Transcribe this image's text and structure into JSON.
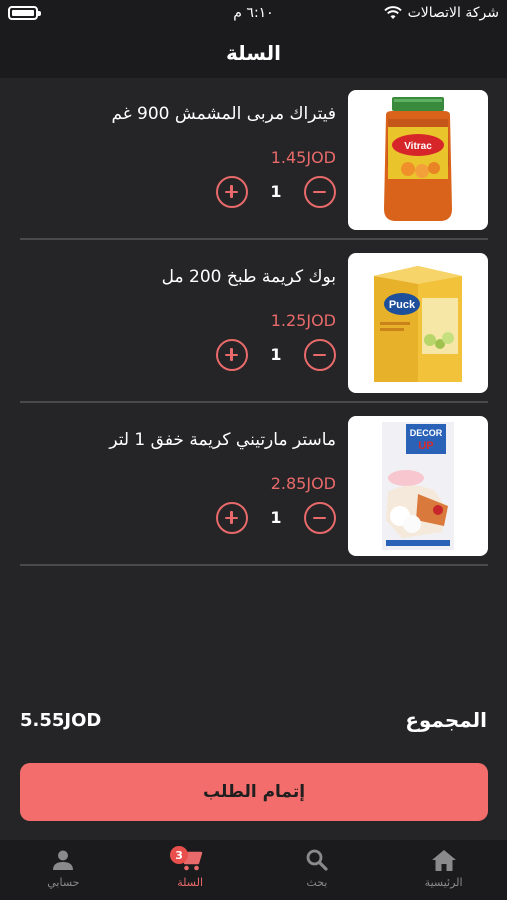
{
  "status_bar": {
    "carrier": "شركة الاتصالات",
    "time": "٦:١٠ م"
  },
  "header": {
    "title": "السلة"
  },
  "cart": {
    "items": [
      {
        "name": "فيتراك مربى المشمش 900 غم",
        "price": "1.45JOD",
        "quantity": "1",
        "image_icon": "jam-jar-image"
      },
      {
        "name": "بوك كريمة طبخ 200 مل",
        "price": "1.25JOD",
        "quantity": "1",
        "image_icon": "cream-carton-image"
      },
      {
        "name": "ماستر مارتيني كريمة خفق 1 لتر",
        "price": "2.85JOD",
        "quantity": "1",
        "image_icon": "whipping-cream-image"
      }
    ],
    "image_labels": {
      "jam": "Vitrac",
      "cream": "Puck",
      "decor_1": "DECOR",
      "decor_2": "UP"
    },
    "total_label": "المجموع",
    "total_value": "5.55JOD",
    "checkout_label": "إتمام الطلب"
  },
  "tab_bar": {
    "tabs": [
      {
        "label": "حسابي",
        "icon": "person-icon"
      },
      {
        "label": "السلة",
        "icon": "cart-icon",
        "badge": "3",
        "active": true
      },
      {
        "label": "بحث",
        "icon": "search-icon"
      },
      {
        "label": "الرئيسية",
        "icon": "home-icon"
      }
    ]
  },
  "colors": {
    "background": "#252528",
    "bar": "#1b1b1d",
    "accent": "#e96a6a",
    "button": "#f26d6b",
    "divider": "#4a4a4d"
  }
}
